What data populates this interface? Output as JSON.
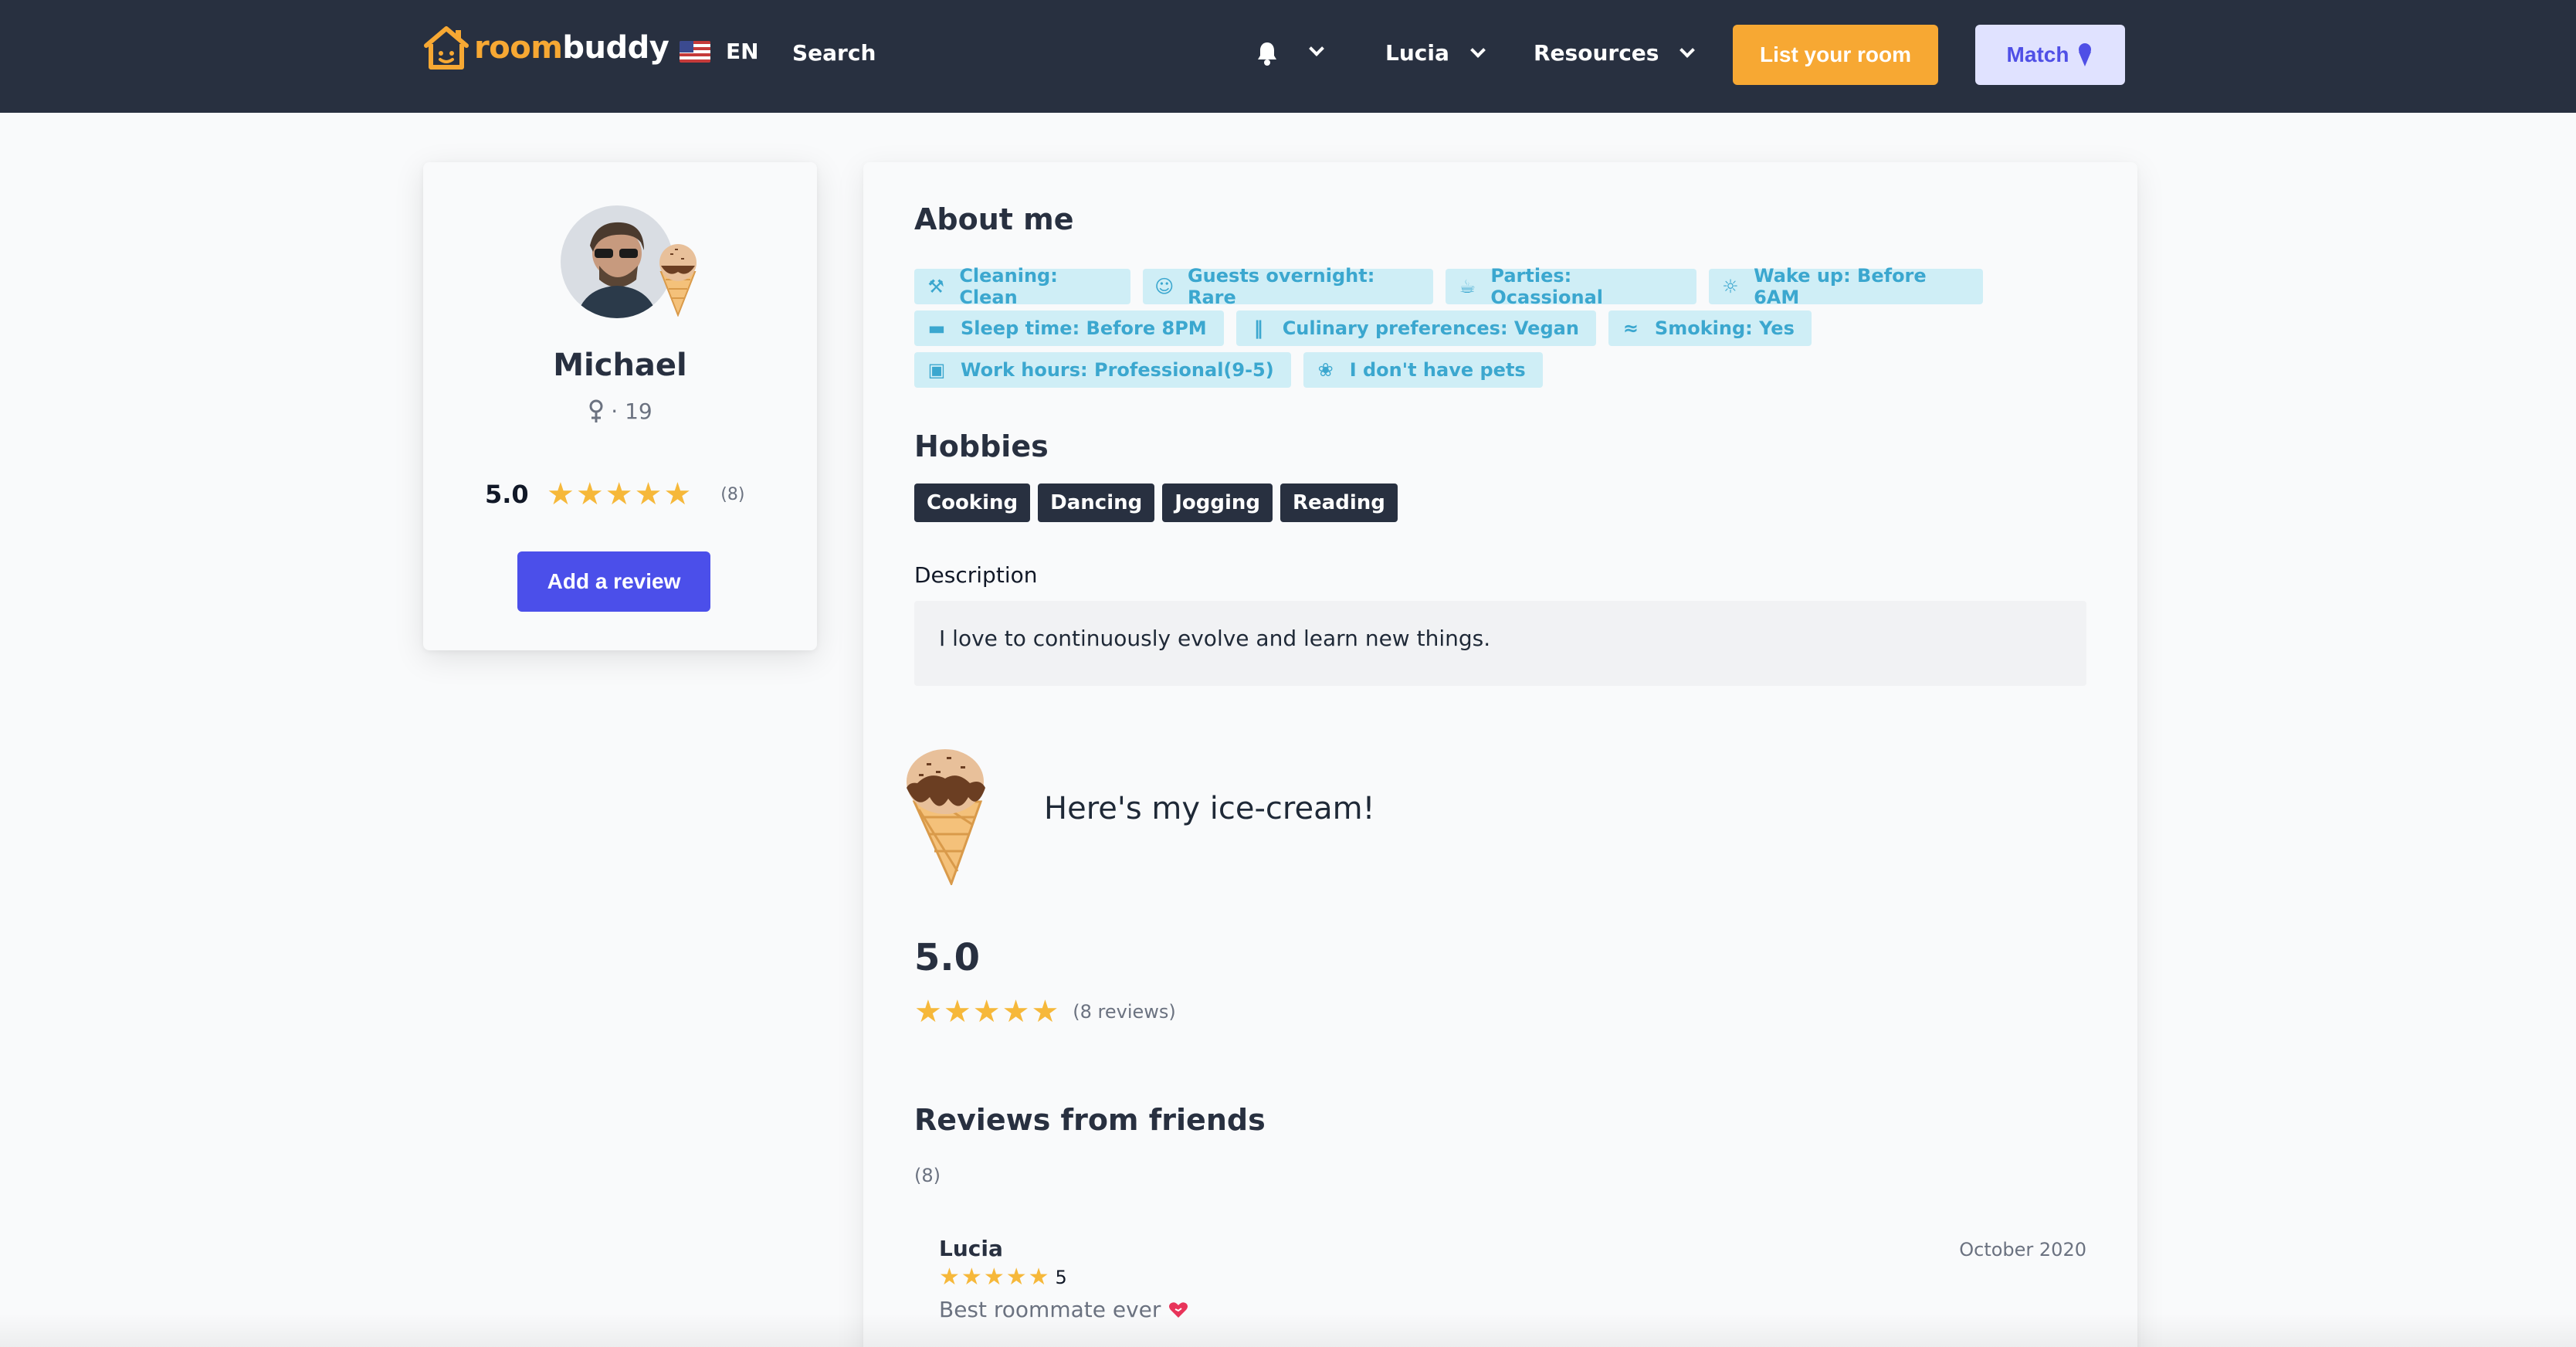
{
  "nav": {
    "logo_room": "room",
    "logo_buddy": "buddy",
    "lang": "EN",
    "search": "Search",
    "user": "Lucia",
    "resources": "Resources",
    "list_room": "List your room",
    "match": "Match"
  },
  "colors": {
    "nav_bg": "#283040",
    "brand_orange": "#f7a833",
    "primary": "#4b4fea",
    "tag_bg": "#cfeef6",
    "tag_text": "#3ba7cf",
    "star": "#f6b83a"
  },
  "profile": {
    "name": "Michael",
    "meta": "· 19",
    "gender_icon": "female-icon",
    "rating": "5.0",
    "rating_value": 5,
    "rating_count": "(8)",
    "add_review": "Add a review"
  },
  "about": {
    "title": "About me",
    "tags": [
      [
        {
          "icon": "broom-icon",
          "label": "Cleaning: Clean"
        },
        {
          "icon": "users-icon",
          "label": "Guests overnight: Rare"
        },
        {
          "icon": "glasses-cheers-icon",
          "label": "Parties: Ocassional"
        },
        {
          "icon": "sun-icon",
          "label": "Wake up: Before 6AM"
        }
      ],
      [
        {
          "icon": "bed-icon",
          "label": "Sleep time: Before 8PM"
        },
        {
          "icon": "utensils-icon",
          "label": "Culinary preferences: Vegan"
        },
        {
          "icon": "smoking-icon",
          "label": "Smoking: Yes"
        }
      ],
      [
        {
          "icon": "briefcase-icon",
          "label": "Work hours: Professional(9-5)"
        },
        {
          "icon": "paw-icon",
          "label": "I don't have pets"
        }
      ]
    ]
  },
  "hobbies": {
    "title": "Hobbies",
    "items": [
      "Cooking",
      "Dancing",
      "Jogging",
      "Reading"
    ]
  },
  "description": {
    "label": "Description",
    "text": "I love to continuously evolve and learn new things."
  },
  "icecream": {
    "text": "Here's my ice-cream!"
  },
  "summary": {
    "rating": "5.0",
    "stars": 5,
    "reviews": "(8 reviews)"
  },
  "friends": {
    "title": "Reviews from friends",
    "count": "(8)",
    "reviews": [
      {
        "name": "Lucia",
        "date": "October 2020",
        "stars": 5,
        "score": "5",
        "text": "Best roommate ever"
      }
    ]
  }
}
